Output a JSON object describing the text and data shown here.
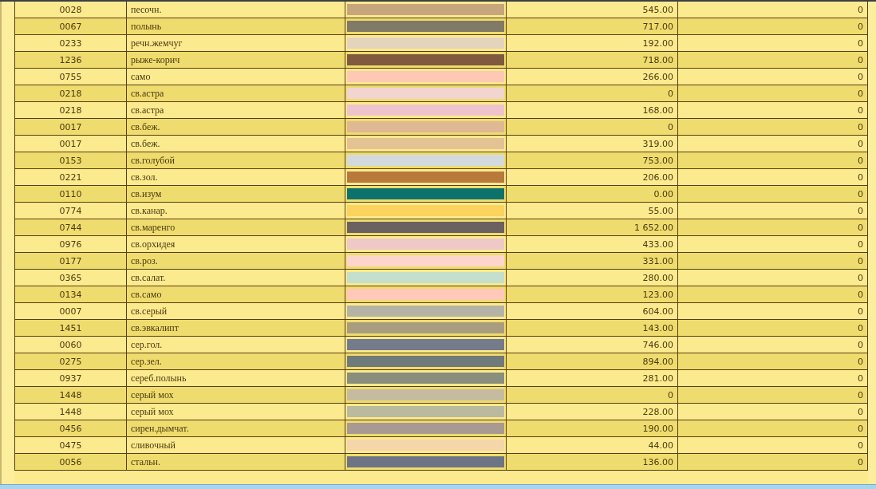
{
  "rows": [
    {
      "code": "0028",
      "name": "песочн.",
      "color": "#c8a67c",
      "amount": "545.00",
      "count": "0"
    },
    {
      "code": "0067",
      "name": "полынь",
      "color": "#817a66",
      "amount": "717.00",
      "count": "0"
    },
    {
      "code": "0233",
      "name": "речн.жемчуг",
      "color": "#e5d4bc",
      "amount": "192.00",
      "count": "0"
    },
    {
      "code": "1236",
      "name": "рыже-корич",
      "color": "#7f5a3f",
      "amount": "718.00",
      "count": "0"
    },
    {
      "code": "0755",
      "name": "само",
      "color": "#ffc8b4",
      "amount": "266.00",
      "count": "0"
    },
    {
      "code": "0218",
      "name": "св.астра",
      "color": "#f2d4d0",
      "amount": "0",
      "count": "0"
    },
    {
      "code": "0218",
      "name": "св.астра",
      "color": "#eec4cc",
      "amount": "168.00",
      "count": "0"
    },
    {
      "code": "0017",
      "name": "св.беж.",
      "color": "#dfb894",
      "amount": "0",
      "count": "0"
    },
    {
      "code": "0017",
      "name": "св.беж.",
      "color": "#e3c394",
      "amount": "319.00",
      "count": "0"
    },
    {
      "code": "0153",
      "name": "св.голубой",
      "color": "#d3dade",
      "amount": "753.00",
      "count": "0"
    },
    {
      "code": "0221",
      "name": "св.зол.",
      "color": "#b9793a",
      "amount": "206.00",
      "count": "0"
    },
    {
      "code": "0110",
      "name": "св.изум",
      "color": "#0e726c",
      "amount": "0.00",
      "count": "0"
    },
    {
      "code": "0774",
      "name": "св.канар.",
      "color": "#fbd35e",
      "amount": "55.00",
      "count": "0"
    },
    {
      "code": "0744",
      "name": "св.маренго",
      "color": "#6a6160",
      "amount": "1 652.00",
      "count": "0"
    },
    {
      "code": "0976",
      "name": "св.орхидея",
      "color": "#efc9c8",
      "amount": "433.00",
      "count": "0"
    },
    {
      "code": "0177",
      "name": "св.роз.",
      "color": "#fcd5cc",
      "amount": "331.00",
      "count": "0"
    },
    {
      "code": "0365",
      "name": "св.салат.",
      "color": "#c4dfcb",
      "amount": "280.00",
      "count": "0"
    },
    {
      "code": "0134",
      "name": "св.само",
      "color": "#ffc8b8",
      "amount": "123.00",
      "count": "0"
    },
    {
      "code": "0007",
      "name": "св.серый",
      "color": "#b5b3a6",
      "amount": "604.00",
      "count": "0"
    },
    {
      "code": "1451",
      "name": "св.эвкалипт",
      "color": "#a99d80",
      "amount": "143.00",
      "count": "0"
    },
    {
      "code": "0060",
      "name": "сер.гол.",
      "color": "#747b8a",
      "amount": "746.00",
      "count": "0"
    },
    {
      "code": "0275",
      "name": "сер.зел.",
      "color": "#6f7a7a",
      "amount": "894.00",
      "count": "0"
    },
    {
      "code": "0937",
      "name": "сереб.полынь",
      "color": "#8a8e7c",
      "amount": "281.00",
      "count": "0"
    },
    {
      "code": "1448",
      "name": "серый мох",
      "color": "#c4bba0",
      "amount": "0",
      "count": "0"
    },
    {
      "code": "1448",
      "name": "серый мох",
      "color": "#babaa0",
      "amount": "228.00",
      "count": "0"
    },
    {
      "code": "0456",
      "name": "сирен.дымчат.",
      "color": "#a89a92",
      "amount": "190.00",
      "count": "0"
    },
    {
      "code": "0475",
      "name": "сливочный",
      "color": "#f4d6aa",
      "amount": "44.00",
      "count": "0"
    },
    {
      "code": "0056",
      "name": "стальн.",
      "color": "#6d7486",
      "amount": "136.00",
      "count": "0"
    }
  ]
}
